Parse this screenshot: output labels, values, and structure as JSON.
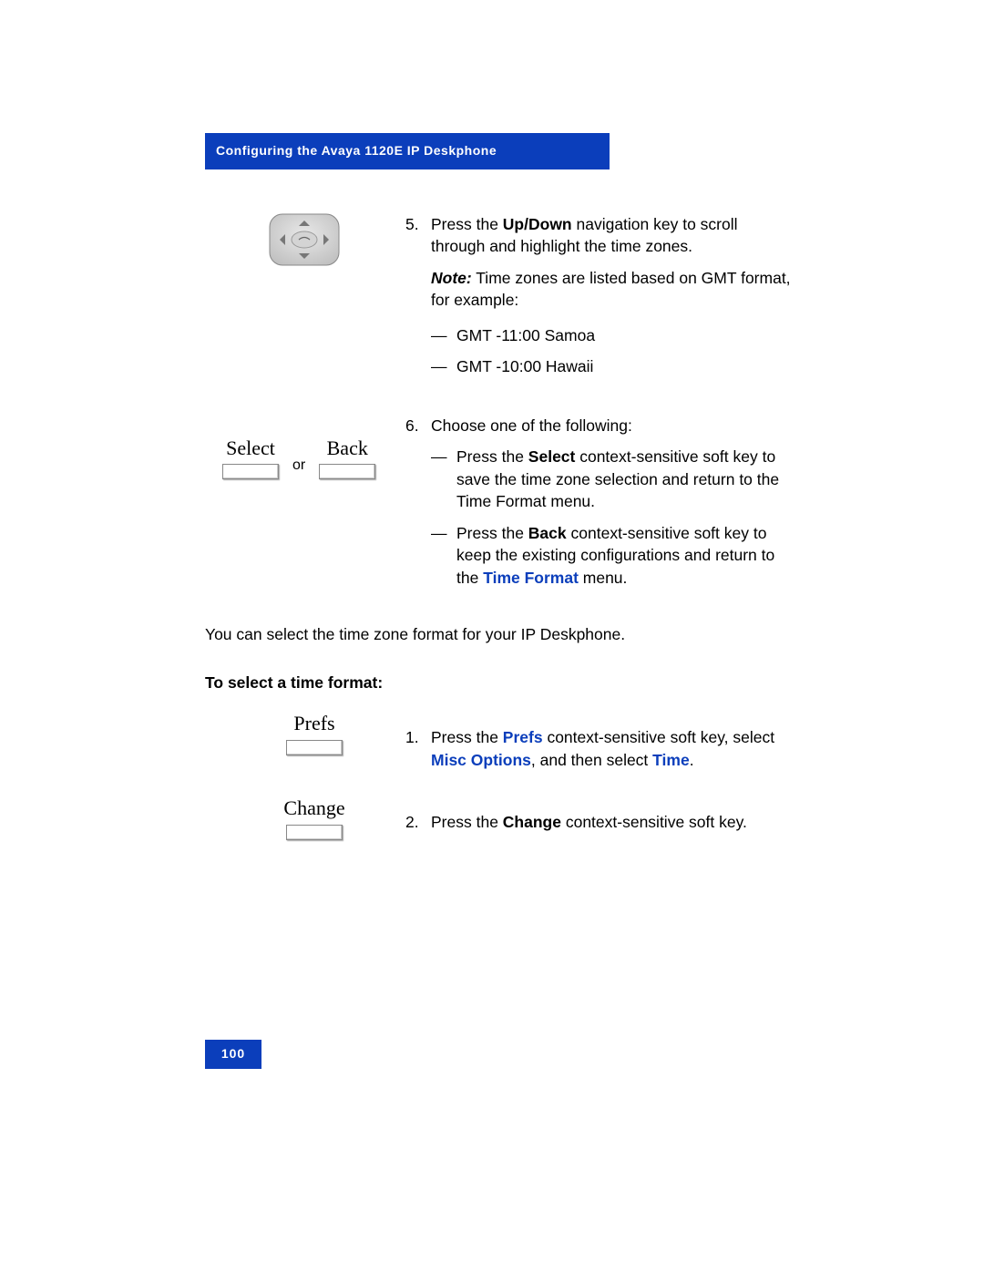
{
  "header": "Configuring the Avaya 1120E IP Deskphone",
  "step5": {
    "num": "5.",
    "line1_pre": "Press the ",
    "updown": "Up/Down",
    "line1_post": " navigation key to scroll through and highlight the time zones.",
    "note_label": "Note:",
    "note_text": "  Time zones are listed based on GMT format, for example:",
    "gmt1_dash": "—",
    "gmt1": "GMT -11:00 Samoa",
    "gmt2_dash": "—",
    "gmt2": "GMT -10:00 Hawaii"
  },
  "keys": {
    "select": "Select",
    "back": "Back",
    "or": "or",
    "prefs": "Prefs",
    "change": "Change"
  },
  "step6": {
    "num": "6.",
    "line": "Choose one of the following:",
    "opt1_dash": "—",
    "opt1_pre": "Press the ",
    "opt1_key": "Select",
    "opt1_post": " context-sensitive soft key to save the time zone selection and return to the Time Format menu.",
    "opt2_dash": "—",
    "opt2_pre": "Press the ",
    "opt2_key": "Back",
    "opt2_mid": " context-sensitive soft key to keep the existing configurations and return to the ",
    "opt2_tf": "Time Format",
    "opt2_post": " menu."
  },
  "para1": "You can select the time zone format for your IP Deskphone.",
  "section": "To select a time format:",
  "b_step1": {
    "num": "1.",
    "pre": "Press the ",
    "prefs": "Prefs",
    "mid1": " context-sensitive soft key, select ",
    "misc": "Misc Options",
    "mid2": ", and then select ",
    "time": "Time",
    "post": "."
  },
  "b_step2": {
    "num": "2.",
    "pre": "Press the ",
    "change": "Change",
    "post": " context-sensitive soft key."
  },
  "page_num": "100"
}
